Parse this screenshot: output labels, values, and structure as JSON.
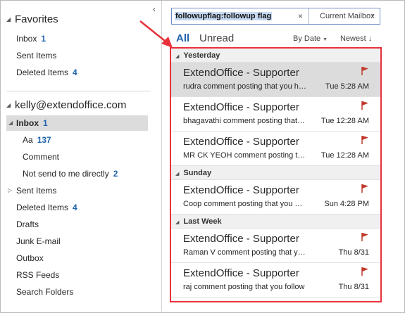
{
  "nav": {
    "favorites_label": "Favorites",
    "favorites": [
      {
        "label": "Inbox",
        "count": "1"
      },
      {
        "label": "Sent Items",
        "count": ""
      },
      {
        "label": "Deleted Items",
        "count": "4"
      }
    ],
    "account_label": "kelly@extendoffice.com",
    "folders": [
      {
        "label": "Inbox",
        "count": "1"
      },
      {
        "label": "Aa",
        "count": "137"
      },
      {
        "label": "Comment",
        "count": ""
      },
      {
        "label": "Not send to me directly",
        "count": "2"
      },
      {
        "label": "Sent Items",
        "count": ""
      },
      {
        "label": "Deleted Items",
        "count": "4"
      },
      {
        "label": "Drafts",
        "count": ""
      },
      {
        "label": "Junk E-mail",
        "count": ""
      },
      {
        "label": "Outbox",
        "count": ""
      },
      {
        "label": "RSS Feeds",
        "count": ""
      },
      {
        "label": "Search Folders",
        "count": ""
      }
    ]
  },
  "search": {
    "query": "followupflag:followup flag",
    "clear_icon": "×",
    "scope": "Current Mailbox"
  },
  "filters": {
    "all": "All",
    "unread": "Unread",
    "sort_by": "By Date",
    "sort_order": "Newest"
  },
  "groups": [
    {
      "name": "Yesterday",
      "messages": [
        {
          "sender": "ExtendOffice - Supporter",
          "subject": "rudra comment posting that you have",
          "time": "Tue 5:28 AM",
          "selected": true
        },
        {
          "sender": "ExtendOffice - Supporter",
          "subject": "bhagavathi comment posting that you",
          "time": "Tue 12:28 AM",
          "selected": false
        },
        {
          "sender": "ExtendOffice - Supporter",
          "subject": "MR CK YEOH comment posting that you",
          "time": "Tue 12:28 AM",
          "selected": false
        }
      ]
    },
    {
      "name": "Sunday",
      "messages": [
        {
          "sender": "ExtendOffice - Supporter",
          "subject": "Coop comment posting that you have",
          "time": "Sun 4:28 PM",
          "selected": false
        }
      ]
    },
    {
      "name": "Last Week",
      "messages": [
        {
          "sender": "ExtendOffice - Supporter",
          "subject": "Raman V comment posting that you have",
          "time": "Thu 8/31",
          "selected": false
        },
        {
          "sender": "ExtendOffice - Supporter",
          "subject": "raj comment posting that you follow",
          "time": "Thu 8/31",
          "selected": false
        }
      ]
    }
  ],
  "colors": {
    "accent": "#1f63ad",
    "highlight_border": "#e8313b",
    "flag": "#c0392b",
    "selected_bg": "#dcdcdc"
  }
}
